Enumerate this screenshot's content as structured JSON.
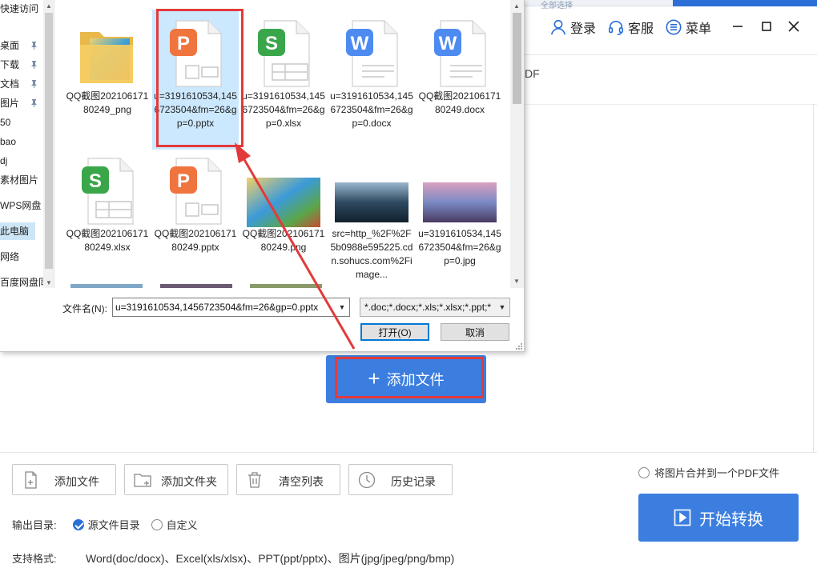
{
  "header": {
    "strip_tab": "全部选择",
    "login_label": "登录",
    "service_label": "客服",
    "menu_label": "菜单"
  },
  "content": {
    "pdf_fragment": "DF"
  },
  "main": {
    "add_file_label": "添加文件"
  },
  "toolbar": {
    "add_file": "添加文件",
    "add_folder": "添加文件夹",
    "clear_list": "清空列表",
    "history": "历史记录"
  },
  "options": {
    "merge_label": "将图片合并到一个PDF文件",
    "output_label": "输出目录:",
    "output_source": "源文件目录",
    "output_custom": "自定义",
    "formats_label": "支持格式:",
    "formats_value": "Word(doc/docx)、Excel(xls/xlsx)、PPT(ppt/pptx)、图片(jpg/jpeg/png/bmp)"
  },
  "start_button": "开始转换",
  "dialog": {
    "nav_items": [
      {
        "label": "快速访问",
        "pinned": false
      },
      {
        "label": "桌面",
        "pinned": true
      },
      {
        "label": "下载",
        "pinned": true
      },
      {
        "label": "文档",
        "pinned": true
      },
      {
        "label": "图片",
        "pinned": true
      },
      {
        "label": "50",
        "pinned": false
      },
      {
        "label": "bao",
        "pinned": false
      },
      {
        "label": "dj",
        "pinned": false
      },
      {
        "label": "素材图片",
        "pinned": false
      },
      {
        "label": "WPS网盘",
        "pinned": false
      },
      {
        "label": "此电脑",
        "pinned": false
      },
      {
        "label": "网络",
        "pinned": false
      },
      {
        "label": "百度网盘同",
        "pinned": false
      }
    ],
    "files": [
      {
        "name": "QQ截图20210617180249_png",
        "type": "folder"
      },
      {
        "name": "u=3191610534,1456723504&fm=26&gp=0.pptx",
        "type": "pptx",
        "selected": true
      },
      {
        "name": "u=3191610534,1456723504&fm=26&gp=0.xlsx",
        "type": "xlsx"
      },
      {
        "name": "u=3191610534,1456723504&fm=26&gp=0.docx",
        "type": "docx"
      },
      {
        "name": "QQ截图20210617180249.docx",
        "type": "docx"
      },
      {
        "name": "QQ截图20210617180249.xlsx",
        "type": "xlsx"
      },
      {
        "name": "QQ截图20210617180249.pptx",
        "type": "pptx"
      },
      {
        "name": "QQ截图20210617180249.png",
        "type": "image-game"
      },
      {
        "name": "src=http_%2F%2F5b0988e595225.cdn.sohucs.com%2Fimage...",
        "type": "image-city"
      },
      {
        "name": "u=3191610534,1456723504&fm=26&gp=0.jpg",
        "type": "image-temple"
      }
    ],
    "filename_label": "文件名(N):",
    "filename_value": "u=3191610534,1456723504&fm=26&gp=0.pptx",
    "filter_value": "*.doc;*.docx;*.xls;*.xlsx;*.ppt;*",
    "open_button": "打开(O)",
    "cancel_button": "取消"
  },
  "colors": {
    "accent": "#3b7ee0",
    "highlight_red": "#e23a3a",
    "selection": "#cce8ff",
    "ppt": "#f0743e",
    "xls": "#3aa64a",
    "doc": "#4d8bf0"
  }
}
